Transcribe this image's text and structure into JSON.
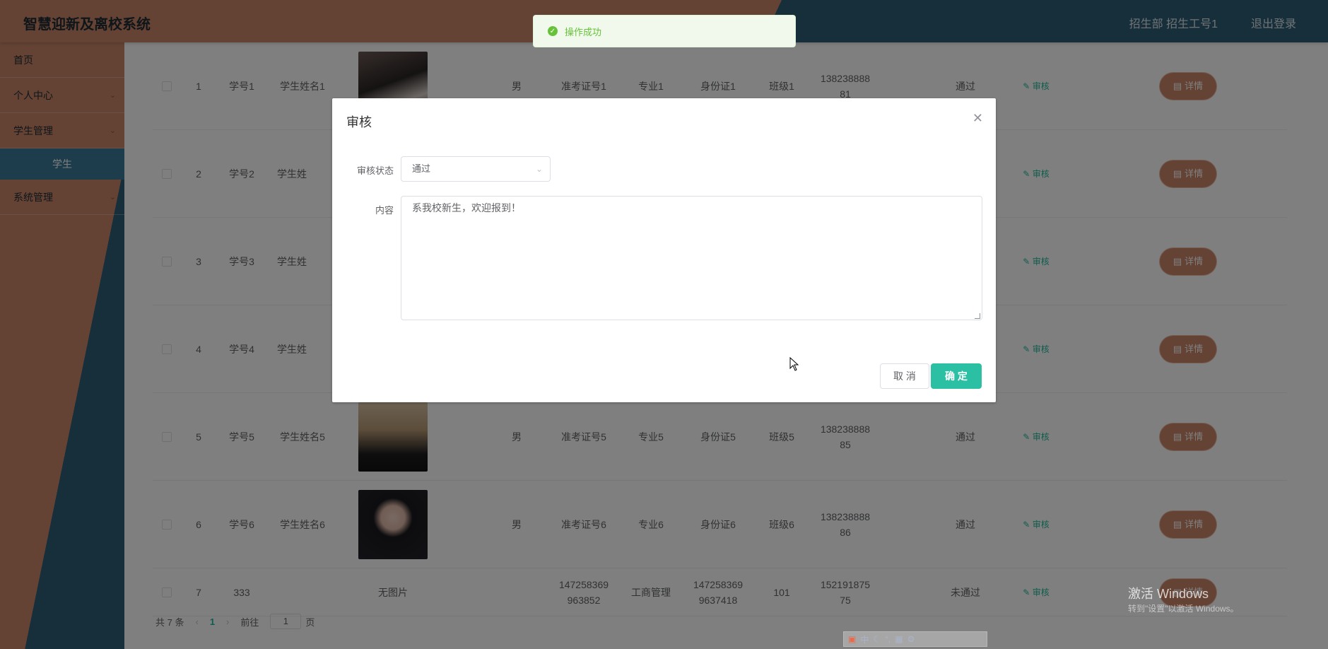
{
  "header": {
    "title": "智慧迎新及离校系统",
    "user": "招生部 招生工号1",
    "logout": "退出登录"
  },
  "sidebar": {
    "items": [
      {
        "label": "首页"
      },
      {
        "label": "个人中心"
      },
      {
        "label": "学生管理"
      },
      {
        "label": "学生"
      },
      {
        "label": "系统管理"
      }
    ]
  },
  "table": {
    "rows": [
      {
        "idx": "1",
        "xh": "学号1",
        "name": "学生姓名1",
        "photo": "photo",
        "sex": "男",
        "zkz": "准考证号1",
        "zy": "专业1",
        "sfz": "身份证1",
        "bj": "班级1",
        "phone1": "138238888",
        "phone2": "81",
        "status": "通过"
      },
      {
        "idx": "2",
        "xh": "学号2",
        "name": "学生姓",
        "status": ""
      },
      {
        "idx": "3",
        "xh": "学号3",
        "name": "学生姓",
        "status": ""
      },
      {
        "idx": "4",
        "xh": "学号4",
        "name": "学生姓",
        "status": ""
      },
      {
        "idx": "5",
        "xh": "学号5",
        "name": "学生姓名5",
        "photo": "photo",
        "sex": "男",
        "zkz": "准考证号5",
        "zy": "专业5",
        "sfz": "身份证5",
        "bj": "班级5",
        "phone1": "138238888",
        "phone2": "85",
        "status": "通过"
      },
      {
        "idx": "6",
        "xh": "学号6",
        "name": "学生姓名6",
        "photo": "photo",
        "sex": "男",
        "zkz": "准考证号6",
        "zy": "专业6",
        "sfz": "身份证6",
        "bj": "班级6",
        "phone1": "138238888",
        "phone2": "86",
        "status": "通过"
      },
      {
        "idx": "7",
        "xh": "333",
        "name": "",
        "nophoto": "无图片",
        "zkz1": "147258369",
        "zkz2": "963852",
        "zy": "工商管理",
        "sfz1": "147258369",
        "sfz2": "9637418",
        "bj": "101",
        "phone1": "152191875",
        "phone2": "75",
        "status": "未通过"
      }
    ],
    "audit_label": "审核",
    "detail_label": "详情"
  },
  "pager": {
    "total": "共 7 条",
    "page": "1",
    "goto_prefix": "前往",
    "goto_value": "1",
    "goto_suffix": "页"
  },
  "toast": {
    "message": "操作成功"
  },
  "dialog": {
    "title": "审核",
    "status_label": "审核状态",
    "status_value": "通过",
    "content_label": "内容",
    "content_value": "系我校新生，欢迎报到！",
    "cancel": "取 消",
    "confirm": "确 定"
  },
  "watermark": {
    "line1": "激活 Windows",
    "line2": "转到\"设置\"以激活 Windows。"
  },
  "ime": {
    "label": "中"
  },
  "colors": {
    "brand_brown": "#c9866a",
    "brand_blue": "#2f5e75",
    "accent_teal": "#2bbfa4",
    "success_green": "#67c23a"
  }
}
